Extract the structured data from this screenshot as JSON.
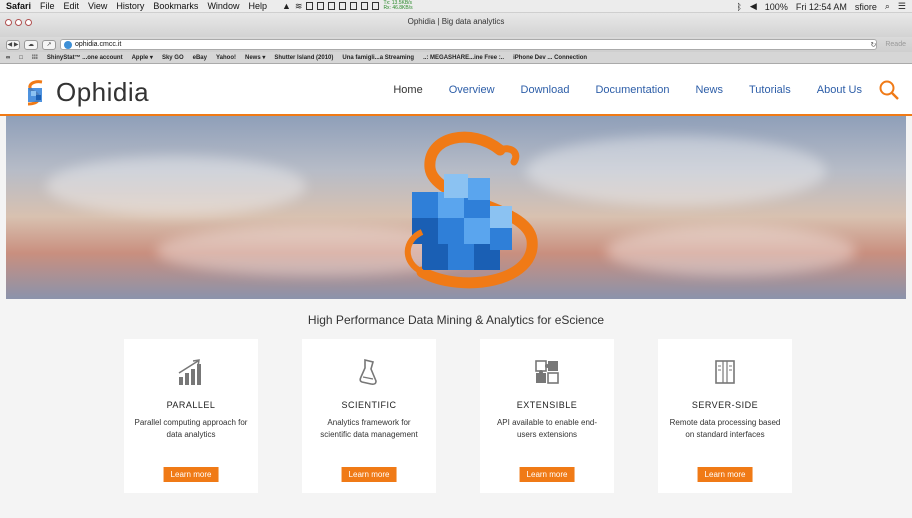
{
  "menubar": {
    "app": "Safari",
    "items": [
      "File",
      "Edit",
      "View",
      "History",
      "Bookmarks",
      "Window",
      "Help"
    ],
    "net_tx": "Tx: 13.5KB/s",
    "net_rx": "Rx: 46.8KB/s",
    "battery": "100%",
    "clock": "Fri 12:54 AM",
    "user": "sfiore"
  },
  "browser": {
    "window_title": "Ophidia | Big data analytics",
    "url": "ophidia.cmcc.it",
    "reader_label": "Reade",
    "bookmarks": [
      "ShinyStat™ ...one account",
      "Apple ▾",
      "Sky GO",
      "eBay",
      "Yahoo!",
      "News ▾",
      "Shutter Island (2010)",
      "Una famigli...a Streaming",
      "..: MEGASHARE...ine Free :..",
      "iPhone Dev ... Connection"
    ]
  },
  "site": {
    "logo_text": "Ophidia",
    "nav": [
      "Home",
      "Overview",
      "Download",
      "Documentation",
      "News",
      "Tutorials",
      "About Us"
    ],
    "tagline": "High Performance Data Mining & Analytics for eScience",
    "cards": [
      {
        "title": "PARALLEL",
        "desc": "Parallel computing approach for data analytics",
        "button": "Learn more",
        "icon": "bar-chart-icon"
      },
      {
        "title": "SCIENTIFIC",
        "desc": "Analytics framework for scientific data management",
        "button": "Learn more",
        "icon": "flask-icon"
      },
      {
        "title": "EXTENSIBLE",
        "desc": "API available to enable end-users extensions",
        "button": "Learn more",
        "icon": "puzzle-icon"
      },
      {
        "title": "SERVER-SIDE",
        "desc": "Remote data processing based on standard interfaces",
        "button": "Learn more",
        "icon": "server-icon"
      }
    ]
  },
  "colors": {
    "accent": "#f07a16",
    "nav_link": "#2d5ea8",
    "cube_blue": "#2f7fd8"
  }
}
